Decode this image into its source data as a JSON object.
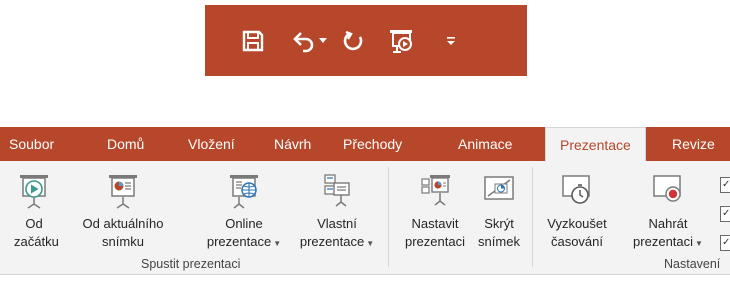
{
  "colors": {
    "accent": "#b7472a",
    "ribbon_bg": "#f3f3f3"
  },
  "quick_access": {
    "buttons": [
      {
        "icon": "save-icon"
      },
      {
        "icon": "undo-icon"
      },
      {
        "icon": "undo-dropdown-icon"
      },
      {
        "icon": "redo-icon"
      },
      {
        "icon": "start-from-beginning-icon"
      },
      {
        "icon": "customize-toolbar-icon"
      }
    ]
  },
  "tabs": [
    "Soubor",
    "Domů",
    "Vložení",
    "Návrh",
    "Přechody",
    "Animace",
    "Prezentace",
    "Revize"
  ],
  "active_tab": "Prezentace",
  "groups": {
    "start": {
      "label": "Spustit prezentaci",
      "from_beginning": {
        "line1": "Od",
        "line2": "začátku"
      },
      "from_current": {
        "line1": "Od aktuálního",
        "line2": "snímku"
      },
      "online": {
        "line1": "Online",
        "line2": "prezentace"
      },
      "custom": {
        "line1": "Vlastní",
        "line2": "prezentace"
      }
    },
    "setup": {
      "label": "Nastavení",
      "setup_show": {
        "line1": "Nastavit",
        "line2": "prezentaci"
      },
      "hide_slide": {
        "line1": "Skrýt",
        "line2": "snímek"
      },
      "rehearse": {
        "line1": "Vyzkoušet",
        "line2": "časování"
      },
      "record": {
        "line1": "Nahrát",
        "line2": "prezentaci"
      }
    }
  }
}
